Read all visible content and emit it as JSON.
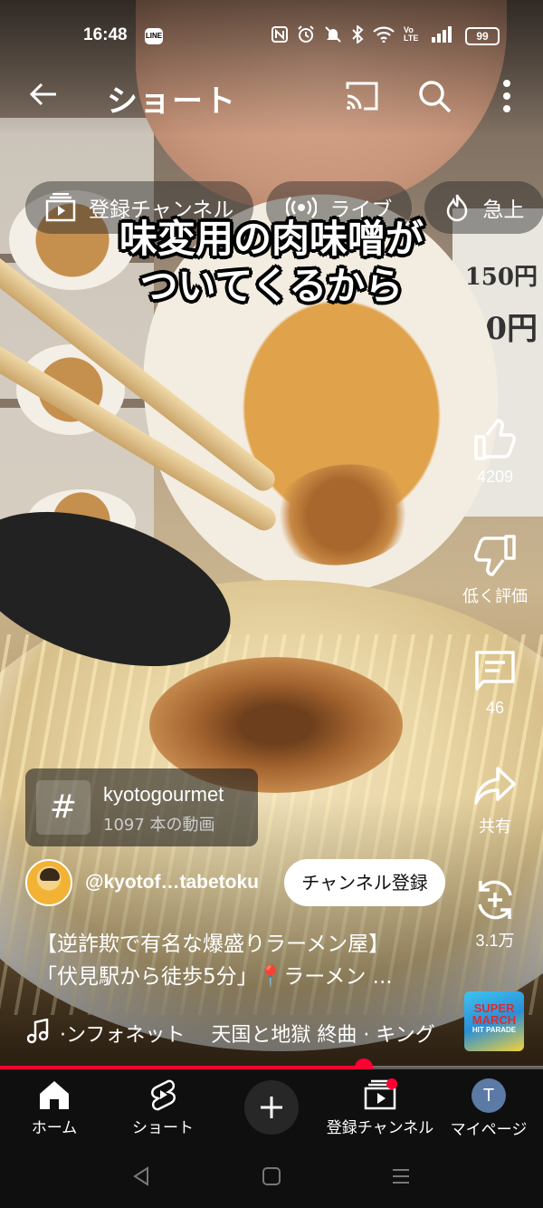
{
  "status_bar": {
    "time": "16:48",
    "line_label": "LINE",
    "battery": "99",
    "icons": [
      "nfc-icon",
      "alarm-icon",
      "mute-icon",
      "bluetooth-icon",
      "wifi-icon",
      "volte-icon",
      "signal-icon"
    ],
    "volte": "Vo LTE"
  },
  "app_bar": {
    "title": "ショート"
  },
  "chips": [
    {
      "label": "登録チャンネル",
      "icon": "subscriptions-icon"
    },
    {
      "label": "ライブ",
      "icon": "live-icon"
    },
    {
      "label": "急上",
      "icon": "trending-icon"
    }
  ],
  "caption": {
    "line1": "味変用の肉味噌が",
    "line2": "ついてくるから"
  },
  "scene_text": {
    "price": "150円",
    "price_partial": "00円"
  },
  "actions": {
    "like_count": "4209",
    "dislike_label": "低く評価",
    "comment_count": "46",
    "share_label": "共有",
    "remix_count": "3.1万"
  },
  "hashtag_card": {
    "name": "kyotogourmet",
    "count": "1097 本の動画"
  },
  "channel": {
    "handle": "@kyotof…tabetoku",
    "subscribe_label": "チャンネル登録"
  },
  "video_title": {
    "line1": "【逆詐欺で有名な爆盛りラーメン屋】",
    "line2": "「伏見駅から徒歩5分」📍ラーメン ..."
  },
  "music": {
    "text": "·ンフォネット　 天国と地獄 終曲 · キング",
    "art_title": "SUPER MARCH",
    "art_subtitle": "HIT PARADE"
  },
  "progress": {
    "fraction": 0.67
  },
  "bottom_nav": [
    {
      "label": "ホーム",
      "icon": "home-icon"
    },
    {
      "label": "ショート",
      "icon": "shorts-icon"
    },
    {
      "label": "",
      "icon": "create-icon"
    },
    {
      "label": "登録チャンネル",
      "icon": "subscriptions-icon"
    },
    {
      "label": "マイページ",
      "icon": "avatar"
    }
  ],
  "my_avatar_letter": "T",
  "colors": {
    "accent": "#ff0033",
    "nav_bg": "#0f0f0f",
    "subscribe_bg": "#ffffff"
  }
}
